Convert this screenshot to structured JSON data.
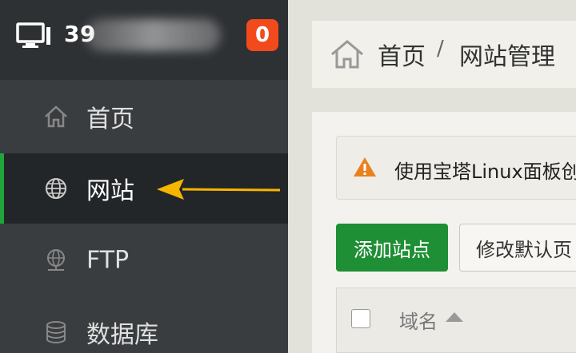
{
  "sidebar": {
    "server_ip_visible": "39",
    "notification_count": "0",
    "items": [
      {
        "label": "首页",
        "icon": "home-icon"
      },
      {
        "label": "网站",
        "icon": "globe-icon",
        "active": true
      },
      {
        "label": "FTP",
        "icon": "ftp-globe-icon"
      },
      {
        "label": "数据库",
        "icon": "database-icon"
      }
    ]
  },
  "breadcrumb": {
    "home": "首页",
    "separator": "/",
    "current": "网站管理"
  },
  "alert": {
    "text": "使用宝塔Linux面板创"
  },
  "toolbar": {
    "add_site_label": "添加站点",
    "modify_default_page_label": "修改默认页"
  },
  "table": {
    "columns": [
      "域名"
    ]
  },
  "colors": {
    "accent": "#20a53a",
    "badge": "#f24a1d",
    "arrow": "#f7b500"
  }
}
